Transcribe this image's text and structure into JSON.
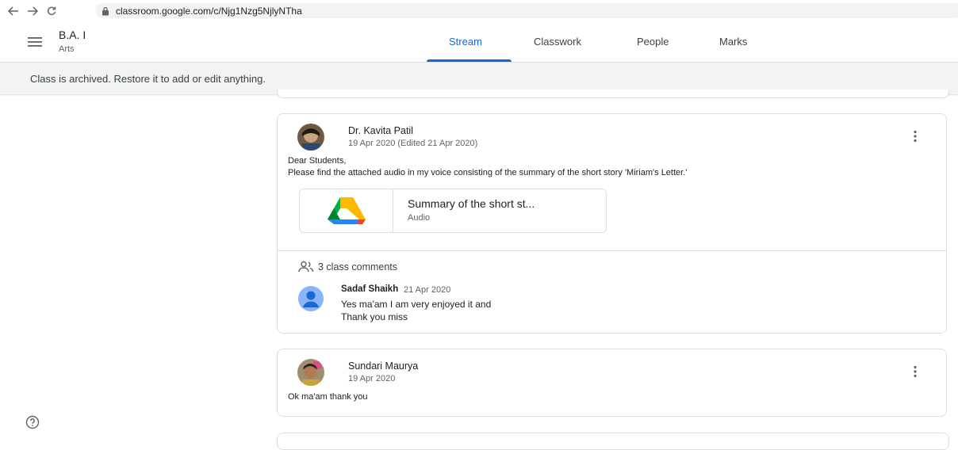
{
  "browser": {
    "url": "classroom.google.com/c/Njg1Nzg5NjlyNTha"
  },
  "header": {
    "class_title": "B.A. I",
    "class_section": "Arts",
    "tabs": [
      {
        "label": "Stream",
        "active": true
      },
      {
        "label": "Classwork",
        "active": false
      },
      {
        "label": "People",
        "active": false
      },
      {
        "label": "Marks",
        "active": false
      }
    ]
  },
  "banner": {
    "text": "Class is archived. Restore it to add or edit anything."
  },
  "posts": [
    {
      "author": "Dr. Kavita Patil",
      "date": "19 Apr 2020 (Edited 21 Apr 2020)",
      "body_lines": [
        "Dear Students,",
        "Please find the attached audio in my voice consisting of the summary of the short story 'Miriam's Letter.'"
      ],
      "attachment": {
        "title": "Summary of the short st...",
        "type": "Audio",
        "icon": "google-drive-icon"
      },
      "comments_count": "3 class comments",
      "comments": [
        {
          "name": "Sadaf Shaikh",
          "date": "21 Apr 2020",
          "lines": [
            "Yes ma'am I am very enjoyed it and",
            "Thank you miss"
          ]
        }
      ]
    },
    {
      "author": "Sundari Maurya",
      "date": "19 Apr 2020",
      "body_lines": [
        "Ok ma'am thank you"
      ]
    }
  ],
  "colors": {
    "accent": "#1967d2",
    "banner_bg": "#f1f3f4",
    "border": "#dadce0",
    "avatar_blue": "#8ab4f8"
  }
}
